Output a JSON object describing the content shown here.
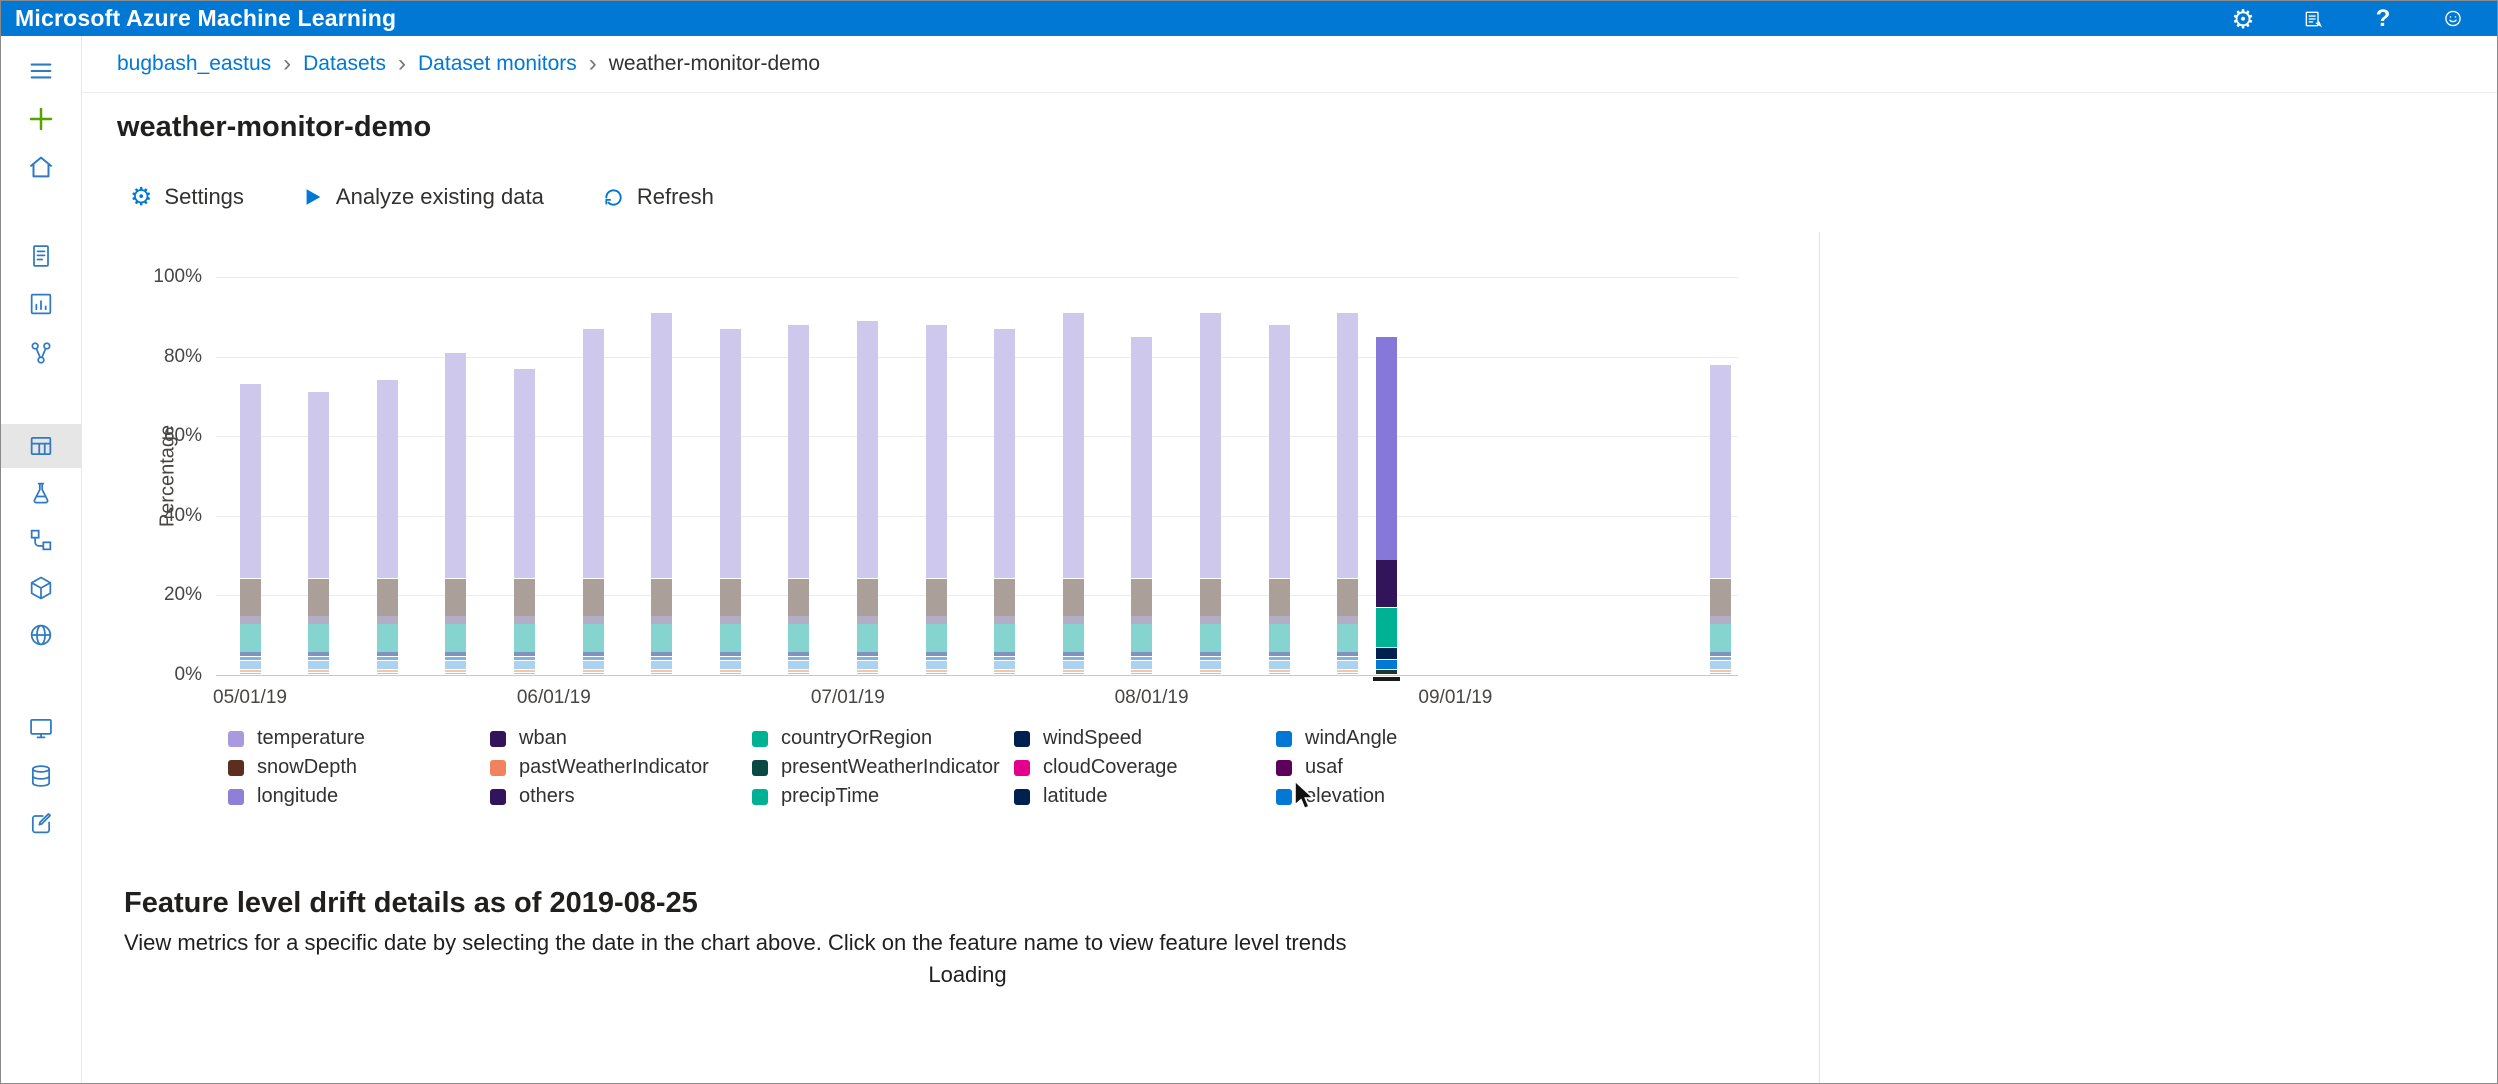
{
  "titlebar": {
    "app_title": "Microsoft Azure Machine Learning",
    "help_label": "?"
  },
  "icons": {
    "gear": "⚙"
  },
  "breadcrumb": {
    "separator": "›",
    "items": [
      "bugbash_eastus",
      "Datasets",
      "Dataset monitors",
      "weather-monitor-demo"
    ]
  },
  "page": {
    "title": "weather-monitor-demo"
  },
  "toolbar": {
    "settings_label": "Settings",
    "analyze_label": "Analyze existing data",
    "refresh_label": "Refresh"
  },
  "drift": {
    "heading": "Feature level drift details as of 2019-08-25",
    "description": "View metrics for a specific date by selecting the date in the chart above. Click on the feature name to view feature level trends",
    "loading": "Loading"
  },
  "chart_data": {
    "type": "bar",
    "stacked": true,
    "title": "",
    "xlabel": "",
    "ylabel": "Percentage",
    "ylim": [
      0,
      100
    ],
    "grid": true,
    "legend_position": "bottom",
    "selected_date": "2019-08-25",
    "yticks": [
      "0%",
      "20%",
      "40%",
      "60%",
      "80%",
      "100%"
    ],
    "xticks": [
      "05/01/19",
      "06/01/19",
      "07/01/19",
      "08/01/19",
      "09/01/19"
    ],
    "legend": [
      {
        "name": "temperature",
        "color": "#a99ae0"
      },
      {
        "name": "wban",
        "color": "#32145a"
      },
      {
        "name": "countryOrRegion",
        "color": "#00b294"
      },
      {
        "name": "windSpeed",
        "color": "#002050"
      },
      {
        "name": "windAngle",
        "color": "#0078d4"
      },
      {
        "name": "snowDepth",
        "color": "#5c2e1e"
      },
      {
        "name": "pastWeatherIndicator",
        "color": "#f0825f"
      },
      {
        "name": "presentWeatherIndicator",
        "color": "#0b4a42"
      },
      {
        "name": "cloudCoverage",
        "color": "#e3008c"
      },
      {
        "name": "usaf",
        "color": "#5c005c"
      },
      {
        "name": "longitude",
        "color": "#8f7fd6"
      },
      {
        "name": "others",
        "color": "#32145a"
      },
      {
        "name": "precipTime",
        "color": "#00b294"
      },
      {
        "name": "latitude",
        "color": "#002050"
      },
      {
        "name": "elevation",
        "color": "#0078d4"
      }
    ],
    "base_segments": [
      {
        "name": "cloudCoverage",
        "color": "#f2a6d4",
        "value": 0.5
      },
      {
        "name": "pastWeatherIndicator",
        "color": "#f6c4a6",
        "value": 0.7
      },
      {
        "name": "elevation",
        "color": "#a9d3f0",
        "value": 2.3
      },
      {
        "name": "windAngle",
        "color": "#7fb3e3",
        "value": 1.0
      },
      {
        "name": "latitude",
        "color": "#8093bd",
        "value": 1.2
      },
      {
        "name": "precipTime",
        "color": "#85d4cf",
        "value": 7.0
      },
      {
        "name": "others",
        "color": "#b3adc6",
        "value": 2.0
      },
      {
        "name": "snowDepth",
        "color": "#aba099",
        "value": 9.5
      }
    ],
    "top_segment": {
      "name": "temperature",
      "color": "#cfc8ed"
    },
    "bars": [
      {
        "date": "2019-05-01",
        "total": 73
      },
      {
        "date": "2019-05-08",
        "total": 71
      },
      {
        "date": "2019-05-15",
        "total": 74
      },
      {
        "date": "2019-05-22",
        "total": 81
      },
      {
        "date": "2019-05-29",
        "total": 77
      },
      {
        "date": "2019-06-05",
        "total": 87
      },
      {
        "date": "2019-06-12",
        "total": 91
      },
      {
        "date": "2019-06-19",
        "total": 87
      },
      {
        "date": "2019-06-26",
        "total": 88
      },
      {
        "date": "2019-07-03",
        "total": 89
      },
      {
        "date": "2019-07-10",
        "total": 88
      },
      {
        "date": "2019-07-17",
        "total": 87
      },
      {
        "date": "2019-07-24",
        "total": 91
      },
      {
        "date": "2019-07-31",
        "total": 85
      },
      {
        "date": "2019-08-07",
        "total": 91
      },
      {
        "date": "2019-08-14",
        "total": 88
      },
      {
        "date": "2019-08-21",
        "total": 91
      },
      {
        "date": "2019-08-25",
        "total": 86,
        "highlight": true,
        "segments": [
          {
            "name": "presentWeatherIndicator",
            "color": "#22342f",
            "value": 1.2
          },
          {
            "name": "elevation",
            "color": "#0078d4",
            "value": 2.6
          },
          {
            "name": "windSpeed",
            "color": "#002050",
            "value": 3.0
          },
          {
            "name": "precipTime",
            "color": "#00b294",
            "value": 10.0
          },
          {
            "name": "wban",
            "color": "#32145a",
            "value": 12.0
          },
          {
            "name": "temperature",
            "color": "#8678d9",
            "value": 56.0
          }
        ]
      },
      {
        "date": "2019-09-28",
        "total": 78
      }
    ]
  }
}
